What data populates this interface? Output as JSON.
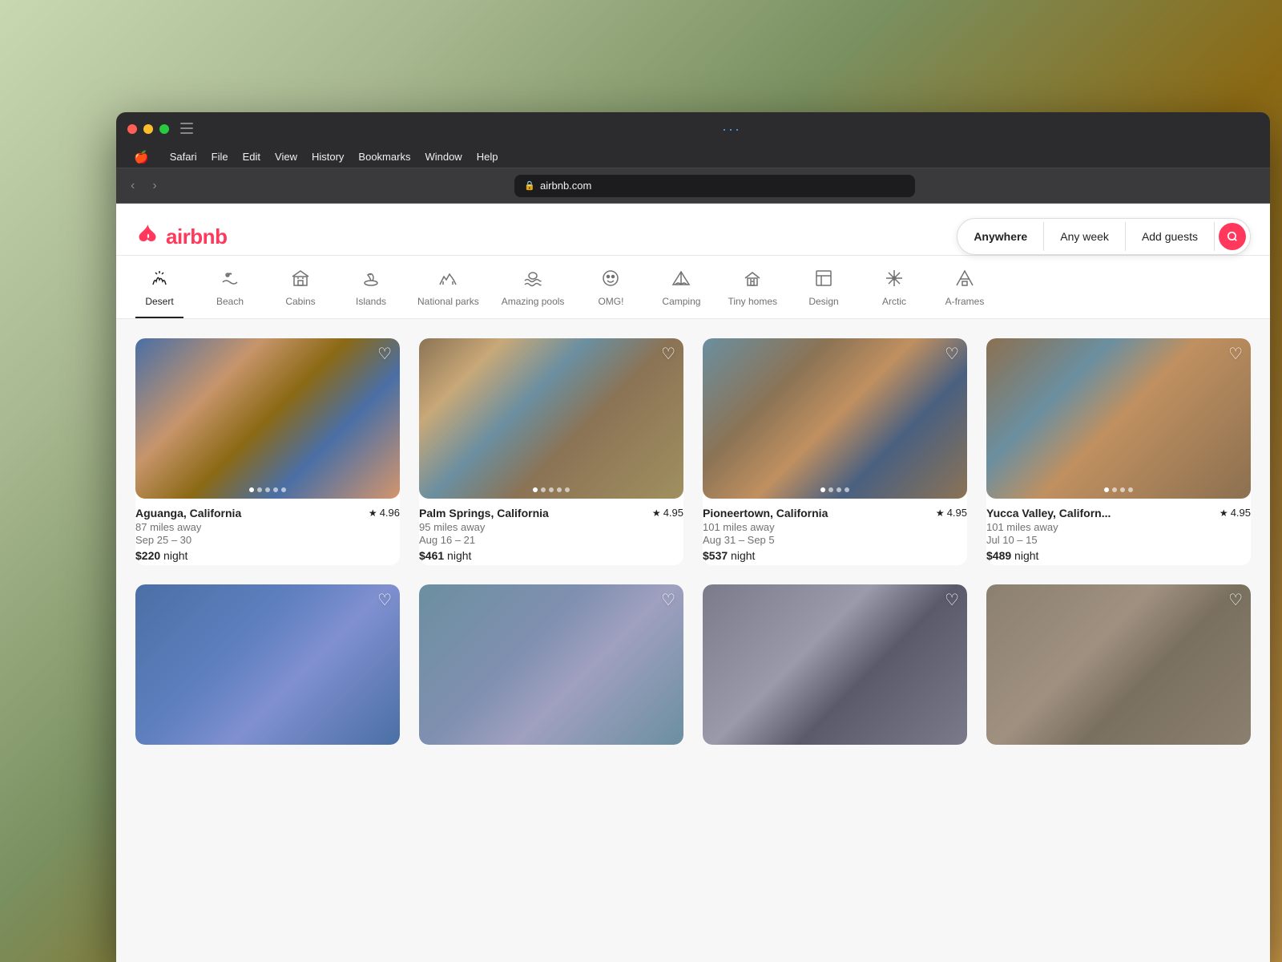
{
  "browser": {
    "menu_items": [
      "🍎",
      "Safari",
      "File",
      "Edit",
      "View",
      "History",
      "Bookmarks",
      "Window",
      "Help"
    ],
    "url": "airbnb.com",
    "back_btn": "‹",
    "forward_btn": "›"
  },
  "header": {
    "logo_text": "airbnb",
    "search": {
      "anywhere": "Anywhere",
      "any_week": "Any week",
      "add_guests": "Add guests",
      "search_icon": "🔍"
    }
  },
  "categories": [
    {
      "id": "desert",
      "label": "Desert",
      "active": true
    },
    {
      "id": "beach",
      "label": "Beach",
      "active": false
    },
    {
      "id": "cabins",
      "label": "Cabins",
      "active": false
    },
    {
      "id": "islands",
      "label": "Islands",
      "active": false
    },
    {
      "id": "national-parks",
      "label": "National parks",
      "active": false
    },
    {
      "id": "amazing-pools",
      "label": "Amazing pools",
      "active": false
    },
    {
      "id": "omg",
      "label": "OMG!",
      "active": false
    },
    {
      "id": "camping",
      "label": "Camping",
      "active": false
    },
    {
      "id": "tiny-homes",
      "label": "Tiny homes",
      "active": false
    },
    {
      "id": "design",
      "label": "Design",
      "active": false
    },
    {
      "id": "arctic",
      "label": "Arctic",
      "active": false
    },
    {
      "id": "a-frames",
      "label": "A-frames",
      "active": false
    }
  ],
  "listings": [
    {
      "id": "aguanga",
      "location": "Aguanga, California",
      "rating": "4.96",
      "distance": "87 miles away",
      "dates": "Sep 25 – 30",
      "price": "$220",
      "price_unit": "night",
      "img_class": "img-aguanga",
      "dots": 5,
      "active_dot": 0
    },
    {
      "id": "palm-springs",
      "location": "Palm Springs, California",
      "rating": "4.95",
      "distance": "95 miles away",
      "dates": "Aug 16 – 21",
      "price": "$461",
      "price_unit": "night",
      "img_class": "img-palmsprings",
      "dots": 5,
      "active_dot": 0
    },
    {
      "id": "pioneertown",
      "location": "Pioneertown, California",
      "rating": "4.95",
      "distance": "101 miles away",
      "dates": "Aug 31 – Sep 5",
      "price": "$537",
      "price_unit": "night",
      "img_class": "img-pioneertown",
      "dots": 4,
      "active_dot": 0
    },
    {
      "id": "yucca-valley",
      "location": "Yucca Valley, Californ...",
      "rating": "4.95",
      "distance": "101 miles away",
      "dates": "Jul 10 – 15",
      "price": "$489",
      "price_unit": "night",
      "img_class": "img-yucca",
      "dots": 4,
      "active_dot": 0
    }
  ],
  "bottom_listings": [
    {
      "id": "b1",
      "img_class": "img-bottom1"
    },
    {
      "id": "b2",
      "img_class": "img-bottom2"
    },
    {
      "id": "b3",
      "img_class": "img-bottom3"
    },
    {
      "id": "b4",
      "img_class": "img-bottom4"
    }
  ],
  "colors": {
    "airbnb_red": "#FF385C",
    "text_primary": "#222222",
    "text_secondary": "#717171"
  }
}
